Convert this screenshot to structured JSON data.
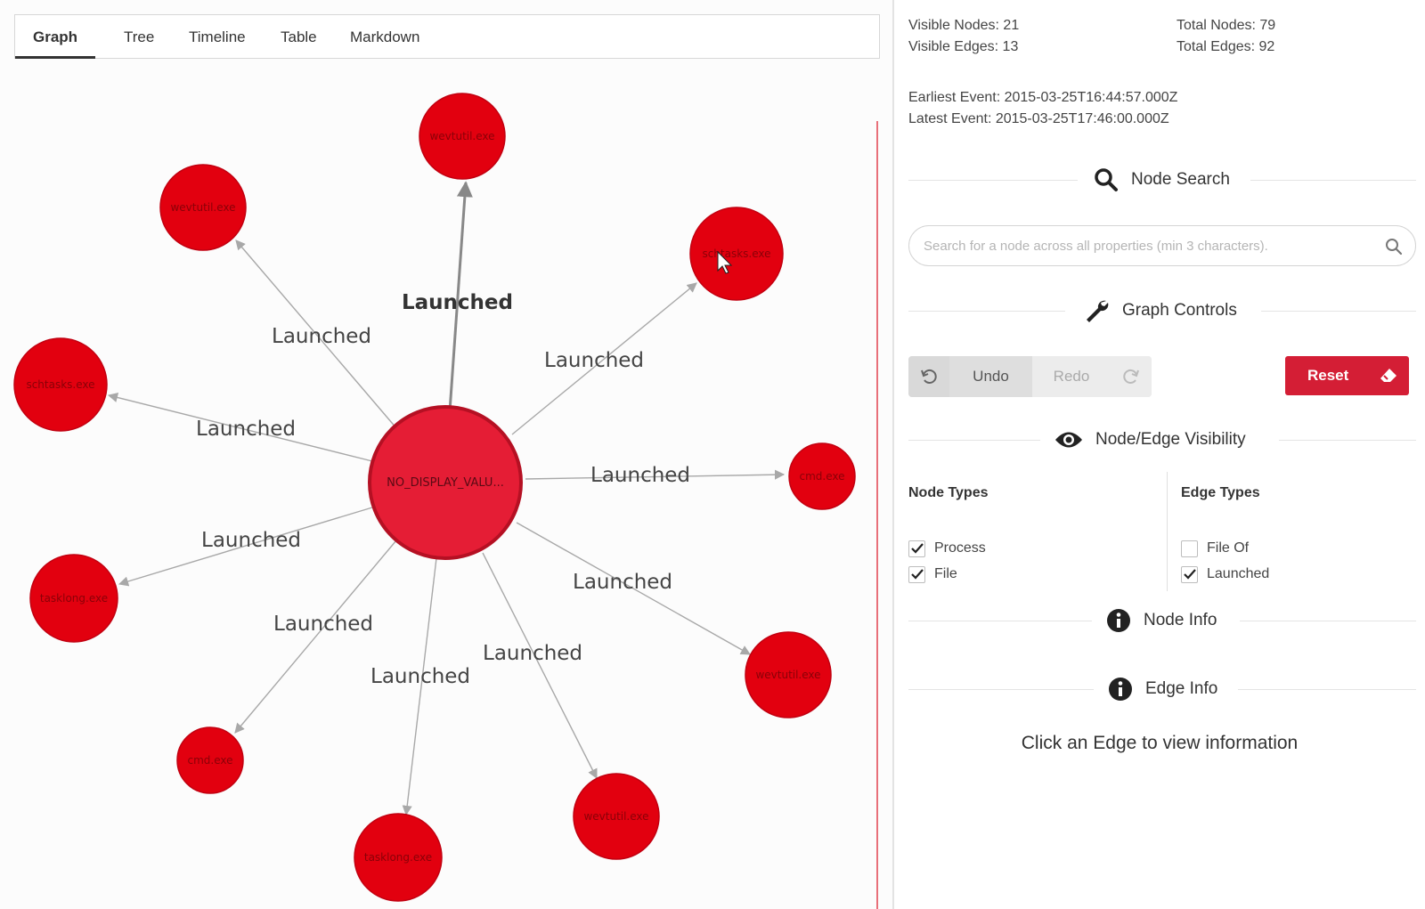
{
  "tabs": [
    "Graph",
    "Tree",
    "Timeline",
    "Table",
    "Markdown"
  ],
  "active_tab": "Graph",
  "graph": {
    "center_node": "NO_DISPLAY_VALU...",
    "nodes": [
      "wevtutil.exe",
      "wevtutil.exe",
      "schtasks.exe",
      "schtasks.exe",
      "cmd.exe",
      "wevtutil.exe",
      "wevtutil.exe",
      "tasklong.exe",
      "cmd.exe",
      "tasklong.exe"
    ],
    "edge_label": "Launched"
  },
  "stats": {
    "visible_nodes": "Visible Nodes: 21",
    "visible_edges": "Visible Edges: 13",
    "total_nodes": "Total Nodes: 79",
    "total_edges": "Total Edges: 92",
    "earliest_event": "Earliest Event: 2015-03-25T16:44:57.000Z",
    "latest_event": "Latest Event: 2015-03-25T17:46:00.000Z"
  },
  "node_search": {
    "title": "Node Search",
    "placeholder": "Search for a node across all properties (min 3 characters).",
    "value": ""
  },
  "graph_controls": {
    "title": "Graph Controls",
    "undo": "Undo",
    "redo": "Redo",
    "reset": "Reset"
  },
  "visibility": {
    "title": "Node/Edge Visibility",
    "node_types_title": "Node Types",
    "edge_types_title": "Edge Types",
    "node_types": [
      {
        "label": "Process",
        "checked": true
      },
      {
        "label": "File",
        "checked": true
      }
    ],
    "edge_types": [
      {
        "label": "File Of",
        "checked": false
      },
      {
        "label": "Launched",
        "checked": true
      }
    ]
  },
  "node_info": {
    "title": "Node Info"
  },
  "edge_info": {
    "title": "Edge Info",
    "hint": "Click an Edge to view information"
  },
  "colors": {
    "node_fill": "#e2000f",
    "center_fill": "#e51d35",
    "reset_button": "#d41e35",
    "edge": "#a8a8a8"
  }
}
